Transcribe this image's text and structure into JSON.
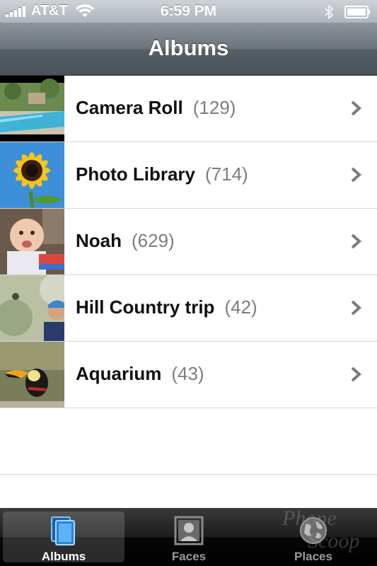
{
  "status_bar": {
    "carrier": "AT&T",
    "time": "6:59 PM"
  },
  "nav": {
    "title": "Albums"
  },
  "albums": [
    {
      "name": "Camera Roll",
      "count": "(129)"
    },
    {
      "name": "Photo Library",
      "count": "(714)"
    },
    {
      "name": "Noah",
      "count": "(629)"
    },
    {
      "name": "Hill Country trip",
      "count": "(42)"
    },
    {
      "name": "Aquarium",
      "count": "(43)"
    }
  ],
  "tabs": [
    {
      "label": "Albums",
      "icon": "albums-icon",
      "selected": true
    },
    {
      "label": "Faces",
      "icon": "faces-icon",
      "selected": false
    },
    {
      "label": "Places",
      "icon": "places-icon",
      "selected": false
    }
  ],
  "watermark": {
    "line1": "Phone",
    "line2": "Scoop"
  }
}
